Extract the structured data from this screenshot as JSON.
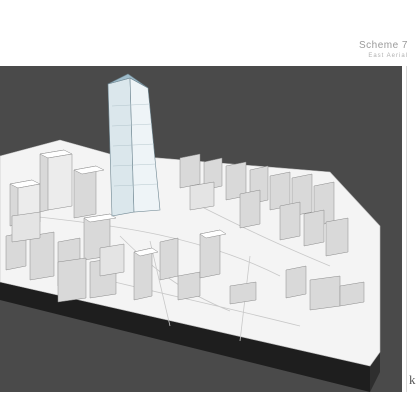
{
  "header": {
    "title": "Scheme 7",
    "subtitle": "East Aerial"
  },
  "logo": {
    "text": "k"
  },
  "colors": {
    "background": "#4a4a4a",
    "ground": "#f4f4f4",
    "building_top": "#ffffff",
    "building_side": "#d9d9d9",
    "tower_glass": "#dbe7ec",
    "tower_crown": "#9fbccb"
  }
}
